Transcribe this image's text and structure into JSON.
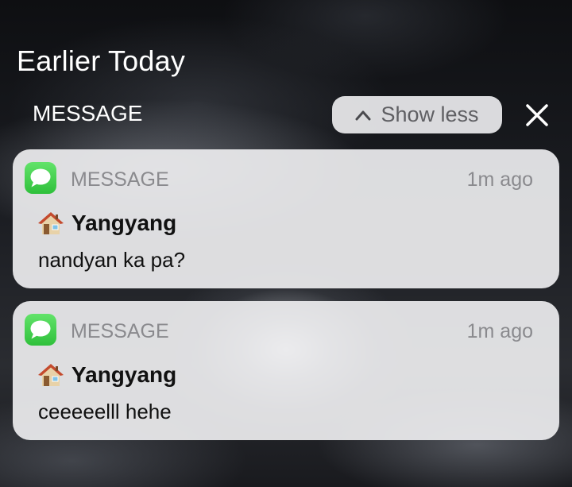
{
  "section": {
    "title": "Earlier Today"
  },
  "group": {
    "label": "MESSAGE",
    "show_less_label": "Show less",
    "chevron_icon": "chevron-up-icon",
    "close_icon": "close-icon"
  },
  "notifications": [
    {
      "app_name": "MESSAGE",
      "app_icon": "messages-app-icon",
      "time": "1m ago",
      "sender_emoji": "house-emoji-icon",
      "sender": "Yangyang",
      "message": "nandyan ka pa?"
    },
    {
      "app_name": "MESSAGE",
      "app_icon": "messages-app-icon",
      "time": "1m ago",
      "sender_emoji": "house-emoji-icon",
      "sender": "Yangyang",
      "message": "ceeeeelll hehe"
    }
  ],
  "colors": {
    "card_background": "#ececee",
    "messages_green": "#34c759",
    "secondary_text": "#8a8a8e"
  }
}
